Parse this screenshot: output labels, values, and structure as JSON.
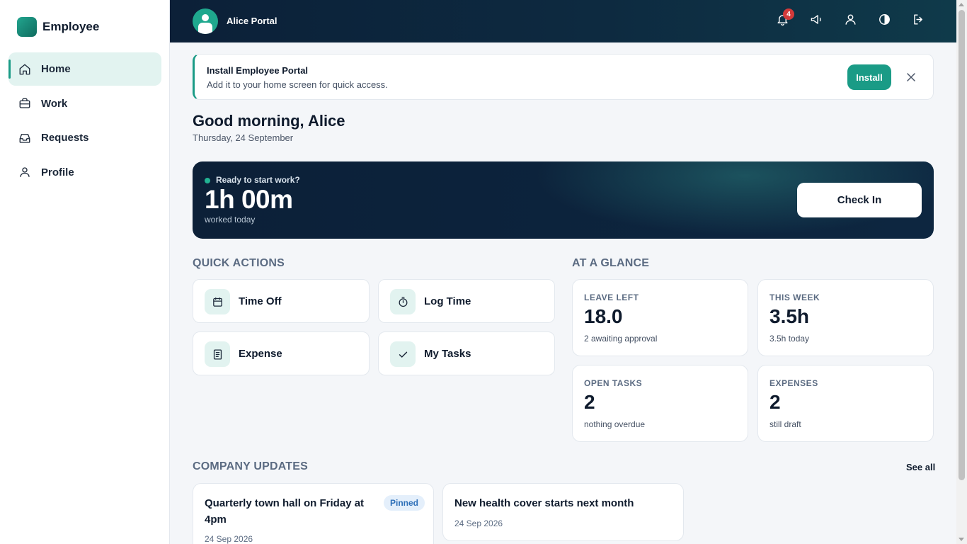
{
  "app": {
    "brand_name": "Employee",
    "portal_name": "Alice Portal",
    "accent_color": "#1a9b86",
    "header_bg": "#0c2038"
  },
  "sidebar": {
    "items": [
      {
        "label": "Home",
        "icon": "home-icon",
        "active": true
      },
      {
        "label": "Work",
        "icon": "briefcase-icon",
        "active": false
      },
      {
        "label": "Requests",
        "icon": "inbox-icon",
        "active": false
      },
      {
        "label": "Profile",
        "icon": "user-icon",
        "active": false
      }
    ]
  },
  "header": {
    "notification_count": "4",
    "icons": [
      "bell-icon",
      "megaphone-icon",
      "user-icon",
      "contrast-icon",
      "logout-icon"
    ]
  },
  "install_banner": {
    "title": "Install Employee Portal",
    "subtitle": "Add it to your home screen for quick access.",
    "button_label": "Install"
  },
  "greeting": {
    "title": "Good morning, Alice",
    "date": "Thursday, 24 September"
  },
  "work_card": {
    "status": "Ready to start work?",
    "hours": "1h 00m",
    "hours_caption": "worked today",
    "button_label": "Check In"
  },
  "quick_actions": {
    "title": "QUICK ACTIONS",
    "items": [
      {
        "label": "Time Off",
        "icon": "calendar-icon"
      },
      {
        "label": "Log Time",
        "icon": "stopwatch-icon"
      },
      {
        "label": "Expense",
        "icon": "receipt-icon"
      },
      {
        "label": "My Tasks",
        "icon": "check-icon"
      }
    ]
  },
  "at_a_glance": {
    "title": "AT A GLANCE",
    "stats": [
      {
        "label": "LEAVE LEFT",
        "value": "18.0",
        "sub": "2 awaiting approval"
      },
      {
        "label": "THIS WEEK",
        "value": "3.5h",
        "sub": "3.5h today"
      },
      {
        "label": "OPEN TASKS",
        "value": "2",
        "sub": "nothing overdue"
      },
      {
        "label": "EXPENSES",
        "value": "2",
        "sub": "still draft"
      }
    ]
  },
  "company_updates": {
    "title": "COMPANY UPDATES",
    "see_all_label": "See all",
    "items": [
      {
        "title": "Quarterly town hall on Friday at 4pm",
        "date": "24 Sep 2026",
        "badge": "Pinned"
      },
      {
        "title": "New health cover starts next month",
        "date": "24 Sep 2026"
      }
    ]
  }
}
